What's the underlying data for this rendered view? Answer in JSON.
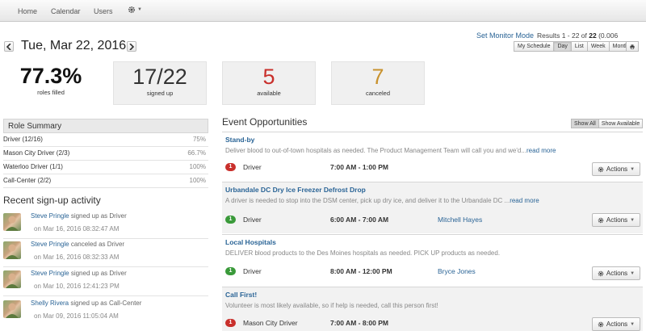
{
  "nav": {
    "items": [
      "Home",
      "Calendar",
      "Users"
    ],
    "settings_icon": "gear-icon"
  },
  "header": {
    "date": "Tue, Mar 22, 2016",
    "monitor_link": "Set Monitor Mode",
    "results_prefix": "Results 1 - 22 of ",
    "results_total": "22",
    "results_suffix": " (0.006 seconds)",
    "views": [
      "My Schedule",
      "Day",
      "List",
      "Week",
      "Month"
    ],
    "active_view": "Day"
  },
  "stats": [
    {
      "value": "77.3%",
      "label": "roles filled",
      "color": "#111111"
    },
    {
      "value": "17/22",
      "label": "signed up",
      "color": "#333333"
    },
    {
      "value": "5",
      "label": "available",
      "color": "#c9302c"
    },
    {
      "value": "7",
      "label": "canceled",
      "color": "#c8922e"
    }
  ],
  "role_summary": {
    "title": "Role Summary",
    "rows": [
      {
        "name": "Driver (12/16)",
        "pct": "75%"
      },
      {
        "name": "Mason City Driver (2/3)",
        "pct": "66.7%"
      },
      {
        "name": "Waterloo Driver (1/1)",
        "pct": "100%"
      },
      {
        "name": "Call-Center (2/2)",
        "pct": "100%"
      }
    ]
  },
  "recent": {
    "title": "Recent sign-up activity",
    "items": [
      {
        "who": "Steve Pringle",
        "action": " signed up as Driver",
        "when": "on Mar 16, 2016 08:32:47 AM"
      },
      {
        "who": "Steve Pringle",
        "action": " canceled as Driver",
        "when": "on Mar 16, 2016 08:32:33 AM"
      },
      {
        "who": "Steve Pringle",
        "action": " signed up as Driver",
        "when": "on Mar 10, 2016 12:41:23 PM"
      },
      {
        "who": "Shelly Rivera",
        "action": " signed up as Call-Center",
        "when": "on Mar 09, 2016 11:05:04 AM"
      }
    ]
  },
  "events": {
    "title": "Event Opportunities",
    "filters": [
      "Show All",
      "Show Available"
    ],
    "active_filter": "Show All",
    "actions_label": "Actions",
    "items": [
      {
        "name": "Stand-by",
        "desc": "Deliver blood to out-of-town hospitals as needed. The Product Management Team will call you and we'd...",
        "more": "read more",
        "badge": "1",
        "badge_color": "#c9302c",
        "role": "Driver",
        "time": "7:00 AM - 1:00 PM",
        "person": ""
      },
      {
        "name": "Urbandale DC Dry Ice Freezer Defrost Drop",
        "desc": "A driver is needed to stop into the DSM center, pick up dry ice, and deliver it to the Urbandale DC ...",
        "more": "read more",
        "badge": "1",
        "badge_color": "#3a9a3a",
        "role": "Driver",
        "time": "6:00 AM - 7:00 AM",
        "person": "Mitchell Hayes"
      },
      {
        "name": "Local Hospitals",
        "desc": "DELIVER blood products to the Des Moines hospitals as needed. PICK UP products as needed.",
        "more": "",
        "badge": "1",
        "badge_color": "#3a9a3a",
        "role": "Driver",
        "time": "8:00 AM - 12:00 PM",
        "person": "Bryce Jones"
      },
      {
        "name": "Call First!",
        "desc": "Volunteer is most likely available, so if help is needed, call this person first!",
        "more": "",
        "badge": "1",
        "badge_color": "#c9302c",
        "role": "Mason City Driver",
        "time": "7:00 AM - 8:00 PM",
        "person": ""
      }
    ]
  }
}
